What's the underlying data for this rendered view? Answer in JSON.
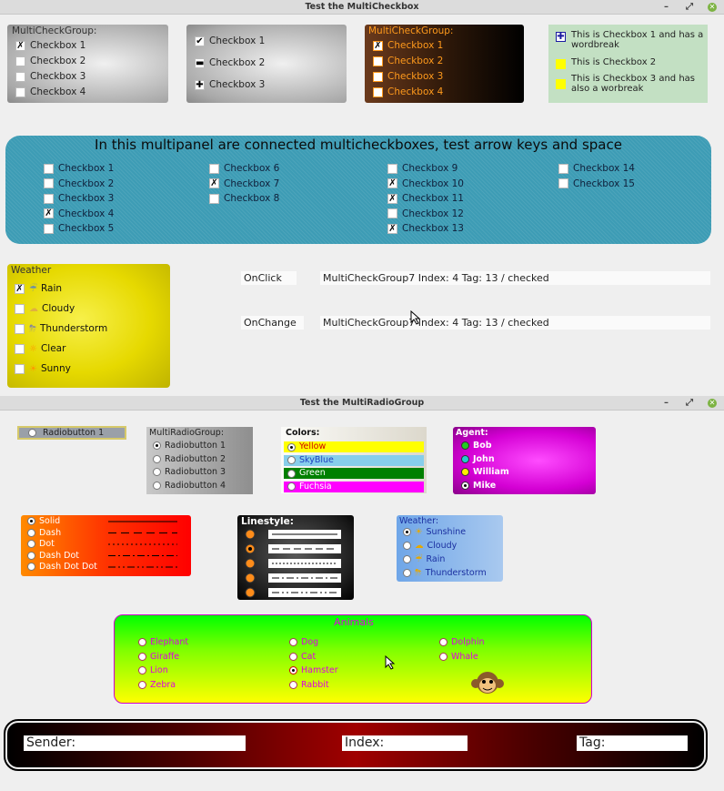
{
  "win1": {
    "title": "Test the MultiCheckbox",
    "min": "–",
    "max": "⤢",
    "close": "✕"
  },
  "g1": {
    "caption": "MultiCheckGroup:",
    "items": [
      "Checkbox 1",
      "Checkbox 2",
      "Checkbox 3",
      "Checkbox 4"
    ],
    "checked": [
      true,
      false,
      false,
      false
    ]
  },
  "g2": {
    "items": [
      "Checkbox 1",
      "Checkbox 2",
      "Checkbox 3"
    ],
    "marks": [
      "✔",
      "▬",
      "✚"
    ]
  },
  "g3": {
    "caption": "MultiCheckGroup:",
    "items": [
      "Checkbox 1",
      "Checkbox 2",
      "Checkbox 3",
      "Checkbox 4"
    ],
    "checked": [
      true,
      false,
      false,
      false
    ]
  },
  "g4": {
    "items": [
      "This is  Checkbox 1 and has a wordbreak",
      "This is Checkbox 2",
      "This is  Checkbox 3 and has also a worbreak"
    ]
  },
  "multipanel": {
    "title": "In this multipanel are connected multicheckboxes, test arrow keys and space",
    "col1": [
      "Checkbox 1",
      "Checkbox 2",
      "Checkbox 3",
      "Checkbox 4",
      "Checkbox 5"
    ],
    "col1_checked": [
      false,
      false,
      false,
      true,
      false
    ],
    "col2": [
      "Checkbox 6",
      "Checkbox 7",
      "Checkbox 8"
    ],
    "col2_checked": [
      false,
      true,
      false
    ],
    "col3": [
      "Checkbox 9",
      "Checkbox 10",
      "Checkbox 11",
      "Checkbox 12",
      "Checkbox 13"
    ],
    "col3_checked": [
      false,
      true,
      true,
      false,
      true
    ],
    "col4": [
      "Checkbox 14",
      "Checkbox 15"
    ],
    "col4_checked": [
      false,
      false
    ]
  },
  "weather": {
    "caption": "Weather",
    "items": [
      "Rain",
      "Cloudy",
      "Thunderstorm",
      "Clear",
      "Sunny"
    ],
    "checked": [
      true,
      false,
      false,
      false,
      false
    ]
  },
  "events": {
    "onclick_label": "OnClick",
    "onclick_value": "MultiCheckGroup7 Index: 4 Tag: 13 / checked",
    "onchange_label": "OnChange",
    "onchange_value": "MultiCheckGroup7 Index: 4 Tag: 13 / checked"
  },
  "win2": {
    "title": "Test the MultiRadioGroup",
    "min": "–",
    "max": "⤢",
    "close": "✕"
  },
  "rb1": {
    "label": "Radiobutton 1"
  },
  "mrg": {
    "caption": "MultiRadioGroup:",
    "items": [
      "Radiobutton 1",
      "Radiobutton 2",
      "Radiobutton 3",
      "Radiobutton 4"
    ],
    "selected": 0
  },
  "colors": {
    "caption": "Colors:",
    "items": [
      "Yellow",
      "SkyBlue",
      "Green",
      "Fuchsia"
    ],
    "selected": 0,
    "swatches": [
      "#ffff00",
      "#87ceeb",
      "#008000",
      "#ff00ff"
    ]
  },
  "agent": {
    "caption": "Agent:",
    "items": [
      "Bob",
      "John",
      "William",
      "Mike"
    ],
    "selected": 3
  },
  "pens": {
    "items": [
      "Solid",
      "Dash",
      "Dot",
      "Dash Dot",
      "Dash Dot Dot"
    ],
    "selected": 0
  },
  "linestyle": {
    "caption": "Linestyle:"
  },
  "weather2": {
    "caption": "Weather:",
    "items": [
      "Sunshine",
      "Cloudy",
      "Rain",
      "Thunderstorm"
    ],
    "selected": 0
  },
  "animals": {
    "caption": "Animals",
    "col1": [
      "Elephant",
      "Giraffe",
      "Lion",
      "Zebra"
    ],
    "col2": [
      "Dog",
      "Cat",
      "Hamster",
      "Rabbit"
    ],
    "col3": [
      "Dolphin",
      "Whale"
    ],
    "selected": "Hamster"
  },
  "status": {
    "sender_label": "Sender:",
    "index_label": "Index:",
    "tag_label": "Tag:"
  }
}
